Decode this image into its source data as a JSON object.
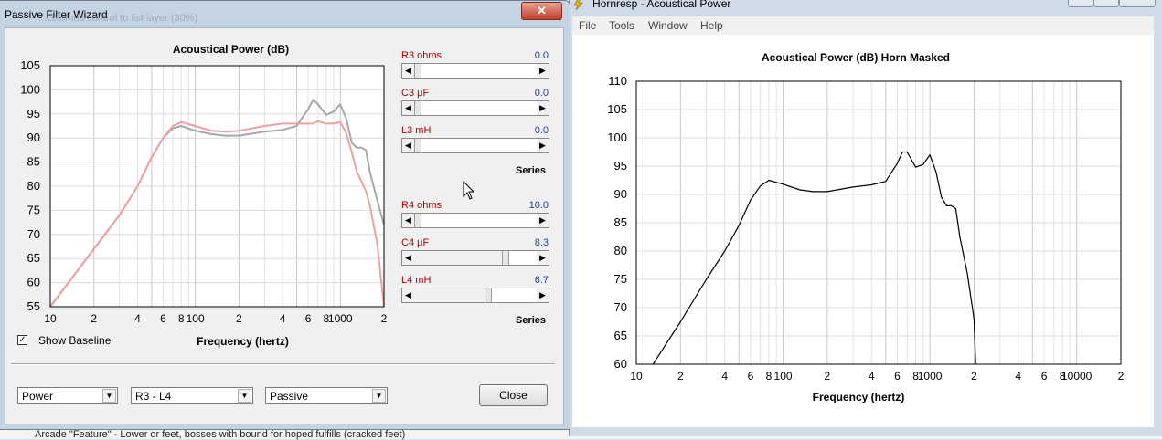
{
  "background": {
    "bottom_text": "Arcade \"Feature\" - Lower or feet, bosses with bound for hoped fulfills (cracked feet)"
  },
  "left_window": {
    "title": "Passive Filter Wizard",
    "close_glyph": "✕",
    "ghost_text": "...columns control to list layer (30%)",
    "checkbox": {
      "checked": true,
      "check_glyph": "✓",
      "label": "Show Baseline"
    },
    "combos": [
      {
        "value": "Power"
      },
      {
        "value": "R3 - L4"
      },
      {
        "value": "Passive"
      }
    ],
    "close_button": "Close",
    "groups": [
      {
        "series_label": "Series",
        "sliders": [
          {
            "label": "R3  ohms",
            "value": "0.0",
            "position": 0.0
          },
          {
            "label": "C3  μF",
            "value": "0.0",
            "position": 0.0
          },
          {
            "label": "L3  mH",
            "value": "0.0",
            "position": 0.0
          }
        ]
      },
      {
        "series_label": "Series",
        "sliders": [
          {
            "label": "R4  ohms",
            "value": "10.0",
            "position": 0.0
          },
          {
            "label": "C4  μF",
            "value": "8.3",
            "position": 0.76
          },
          {
            "label": "L4  mH",
            "value": "6.7",
            "position": 0.61
          }
        ]
      }
    ]
  },
  "right_window": {
    "title": "Hornresp - Acoustical Power",
    "menu": [
      "File",
      "Tools",
      "Window",
      "Help"
    ]
  },
  "chart_data": [
    {
      "type": "line",
      "title": "Acoustical Power (dB)",
      "xlabel": "Frequency (hertz)",
      "ylabel": "",
      "x_scale": "log",
      "xlim": [
        10,
        2000
      ],
      "ylim": [
        55,
        105
      ],
      "yticks": [
        55,
        60,
        65,
        70,
        75,
        80,
        85,
        90,
        95,
        100,
        105
      ],
      "xtick_labels": [
        {
          "x": 10,
          "label": "10"
        },
        {
          "x": 20,
          "label": "2"
        },
        {
          "x": 40,
          "label": "4"
        },
        {
          "x": 60,
          "label": "6"
        },
        {
          "x": 80,
          "label": "8"
        },
        {
          "x": 100,
          "label": "100"
        },
        {
          "x": 200,
          "label": "2"
        },
        {
          "x": 400,
          "label": "4"
        },
        {
          "x": 600,
          "label": "6"
        },
        {
          "x": 800,
          "label": "8"
        },
        {
          "x": 1000,
          "label": "1000"
        },
        {
          "x": 2000,
          "label": "2"
        }
      ],
      "grid": true,
      "series": [
        {
          "color": "#a8a8a8",
          "x": [
            10,
            15,
            20,
            30,
            40,
            50,
            60,
            70,
            80,
            100,
            130,
            160,
            200,
            300,
            400,
            500,
            600,
            650,
            700,
            800,
            900,
            1000,
            1100,
            1200,
            1300,
            1400,
            1500,
            1600,
            1800,
            2000
          ],
          "y": [
            55,
            62,
            67,
            74,
            80,
            86,
            90,
            92,
            92.5,
            91.5,
            90.8,
            90.5,
            90.5,
            91.3,
            91.7,
            92.5,
            96,
            98,
            97,
            94.8,
            95.5,
            97,
            94,
            89,
            88,
            88,
            87.5,
            83,
            77,
            72
          ]
        },
        {
          "color": "#f0a0a0",
          "x": [
            10,
            15,
            20,
            30,
            40,
            50,
            60,
            70,
            80,
            100,
            130,
            160,
            200,
            300,
            400,
            500,
            600,
            650,
            700,
            800,
            900,
            1000,
            1100,
            1200,
            1300,
            1400,
            1500,
            1600,
            1800,
            2000
          ],
          "y": [
            55,
            62,
            67,
            74,
            80,
            86,
            90,
            92.5,
            93.3,
            92.5,
            91.5,
            91.3,
            91.5,
            92.5,
            93,
            93,
            93,
            93,
            93.5,
            93,
            93,
            93.3,
            91,
            87,
            83,
            81,
            79,
            76,
            68,
            55
          ]
        }
      ]
    },
    {
      "type": "line",
      "title": "Acoustical Power (dB)    Horn    Masked",
      "xlabel": "Frequency (hertz)",
      "ylabel": "",
      "x_scale": "log",
      "xlim": [
        10,
        20000
      ],
      "ylim": [
        60,
        110
      ],
      "yticks": [
        60,
        65,
        70,
        75,
        80,
        85,
        90,
        95,
        100,
        105,
        110
      ],
      "xtick_labels": [
        {
          "x": 10,
          "label": "10"
        },
        {
          "x": 20,
          "label": "2"
        },
        {
          "x": 40,
          "label": "4"
        },
        {
          "x": 60,
          "label": "6"
        },
        {
          "x": 80,
          "label": "8"
        },
        {
          "x": 100,
          "label": "100"
        },
        {
          "x": 200,
          "label": "2"
        },
        {
          "x": 400,
          "label": "4"
        },
        {
          "x": 600,
          "label": "6"
        },
        {
          "x": 800,
          "label": "8"
        },
        {
          "x": 1000,
          "label": "1000"
        },
        {
          "x": 2000,
          "label": "2"
        },
        {
          "x": 4000,
          "label": "4"
        },
        {
          "x": 6000,
          "label": "6"
        },
        {
          "x": 8000,
          "label": "8"
        },
        {
          "x": 10000,
          "label": "10000"
        },
        {
          "x": 20000,
          "label": "2"
        }
      ],
      "grid": true,
      "series": [
        {
          "color": "#000000",
          "x": [
            13,
            20,
            30,
            40,
            50,
            60,
            70,
            80,
            100,
            130,
            160,
            200,
            300,
            400,
            500,
            600,
            650,
            700,
            800,
            900,
            1000,
            1100,
            1200,
            1300,
            1400,
            1500,
            1600,
            1800,
            2000,
            2050
          ],
          "y": [
            60,
            67.5,
            75,
            80,
            84.5,
            89,
            91.5,
            92.5,
            91.8,
            90.8,
            90.5,
            90.5,
            91.3,
            91.7,
            92.3,
            95.5,
            97.5,
            97.5,
            94.8,
            95.3,
            97,
            94,
            89.5,
            88,
            88,
            87.5,
            82.5,
            76,
            68,
            60
          ]
        }
      ]
    }
  ]
}
